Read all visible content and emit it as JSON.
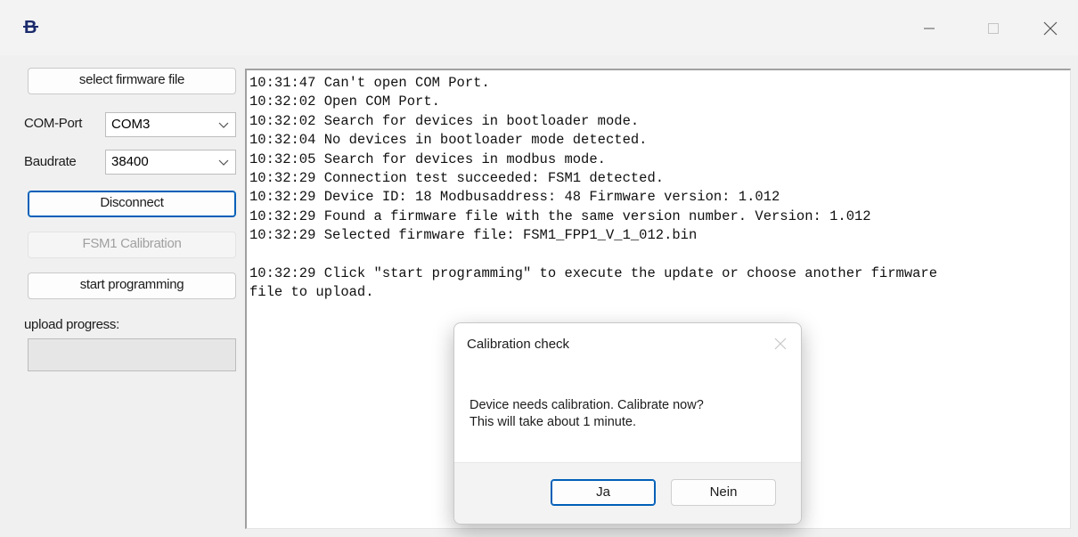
{
  "window": {
    "icon": "B",
    "icon_name": "app-b-logo",
    "controls": [
      "minimize-icon",
      "maximize-icon",
      "close-icon"
    ]
  },
  "sidebar": {
    "select_firmware_label": "select firmware file",
    "com_port_label": "COM-Port",
    "com_port_value": "COM3",
    "baudrate_label": "Baudrate",
    "baudrate_value": "38400",
    "disconnect_label": "Disconnect",
    "calibration_label": "FSM1 Calibration",
    "start_programming_label": "start programming",
    "upload_progress_label": "upload progress:",
    "upload_progress_value": 0
  },
  "log": {
    "lines": [
      "10:31:47 Can't open COM Port.",
      "10:32:02 Open COM Port.",
      "10:32:02 Search for devices in bootloader mode.",
      "10:32:04 No devices in bootloader mode detected.",
      "10:32:05 Search for devices in modbus mode.",
      "10:32:29 Connection test succeeded: FSM1 detected.",
      "10:32:29 Device ID: 18 Modbusaddress: 48 Firmware version: 1.012",
      "10:32:29 Found a firmware file with the same version number. Version: 1.012",
      "10:32:29 Selected firmware file: FSM1_FPP1_V_1_012.bin",
      "",
      "10:32:29 Click \"start programming\" to execute the update or choose another firmware",
      "file to upload."
    ]
  },
  "dialog": {
    "title": "Calibration check",
    "message_line1": "Device needs calibration. Calibrate now?",
    "message_line2": "This will take about 1 minute.",
    "yes_label": "Ja",
    "no_label": "Nein"
  },
  "colors": {
    "accent": "#005fb8",
    "window_bg": "#f0f0f0",
    "log_bg": "#ffffff"
  }
}
